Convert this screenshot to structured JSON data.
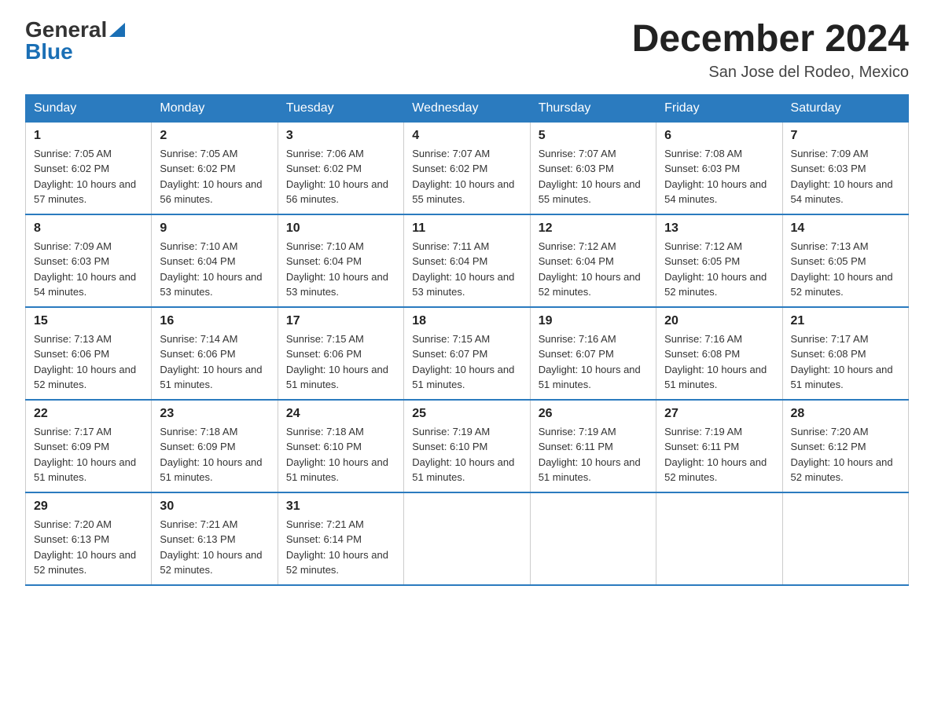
{
  "header": {
    "logo_general": "General",
    "logo_blue": "Blue",
    "title": "December 2024",
    "subtitle": "San Jose del Rodeo, Mexico"
  },
  "columns": [
    "Sunday",
    "Monday",
    "Tuesday",
    "Wednesday",
    "Thursday",
    "Friday",
    "Saturday"
  ],
  "weeks": [
    [
      {
        "day": "1",
        "sunrise": "7:05 AM",
        "sunset": "6:02 PM",
        "daylight": "10 hours and 57 minutes."
      },
      {
        "day": "2",
        "sunrise": "7:05 AM",
        "sunset": "6:02 PM",
        "daylight": "10 hours and 56 minutes."
      },
      {
        "day": "3",
        "sunrise": "7:06 AM",
        "sunset": "6:02 PM",
        "daylight": "10 hours and 56 minutes."
      },
      {
        "day": "4",
        "sunrise": "7:07 AM",
        "sunset": "6:02 PM",
        "daylight": "10 hours and 55 minutes."
      },
      {
        "day": "5",
        "sunrise": "7:07 AM",
        "sunset": "6:03 PM",
        "daylight": "10 hours and 55 minutes."
      },
      {
        "day": "6",
        "sunrise": "7:08 AM",
        "sunset": "6:03 PM",
        "daylight": "10 hours and 54 minutes."
      },
      {
        "day": "7",
        "sunrise": "7:09 AM",
        "sunset": "6:03 PM",
        "daylight": "10 hours and 54 minutes."
      }
    ],
    [
      {
        "day": "8",
        "sunrise": "7:09 AM",
        "sunset": "6:03 PM",
        "daylight": "10 hours and 54 minutes."
      },
      {
        "day": "9",
        "sunrise": "7:10 AM",
        "sunset": "6:04 PM",
        "daylight": "10 hours and 53 minutes."
      },
      {
        "day": "10",
        "sunrise": "7:10 AM",
        "sunset": "6:04 PM",
        "daylight": "10 hours and 53 minutes."
      },
      {
        "day": "11",
        "sunrise": "7:11 AM",
        "sunset": "6:04 PM",
        "daylight": "10 hours and 53 minutes."
      },
      {
        "day": "12",
        "sunrise": "7:12 AM",
        "sunset": "6:04 PM",
        "daylight": "10 hours and 52 minutes."
      },
      {
        "day": "13",
        "sunrise": "7:12 AM",
        "sunset": "6:05 PM",
        "daylight": "10 hours and 52 minutes."
      },
      {
        "day": "14",
        "sunrise": "7:13 AM",
        "sunset": "6:05 PM",
        "daylight": "10 hours and 52 minutes."
      }
    ],
    [
      {
        "day": "15",
        "sunrise": "7:13 AM",
        "sunset": "6:06 PM",
        "daylight": "10 hours and 52 minutes."
      },
      {
        "day": "16",
        "sunrise": "7:14 AM",
        "sunset": "6:06 PM",
        "daylight": "10 hours and 51 minutes."
      },
      {
        "day": "17",
        "sunrise": "7:15 AM",
        "sunset": "6:06 PM",
        "daylight": "10 hours and 51 minutes."
      },
      {
        "day": "18",
        "sunrise": "7:15 AM",
        "sunset": "6:07 PM",
        "daylight": "10 hours and 51 minutes."
      },
      {
        "day": "19",
        "sunrise": "7:16 AM",
        "sunset": "6:07 PM",
        "daylight": "10 hours and 51 minutes."
      },
      {
        "day": "20",
        "sunrise": "7:16 AM",
        "sunset": "6:08 PM",
        "daylight": "10 hours and 51 minutes."
      },
      {
        "day": "21",
        "sunrise": "7:17 AM",
        "sunset": "6:08 PM",
        "daylight": "10 hours and 51 minutes."
      }
    ],
    [
      {
        "day": "22",
        "sunrise": "7:17 AM",
        "sunset": "6:09 PM",
        "daylight": "10 hours and 51 minutes."
      },
      {
        "day": "23",
        "sunrise": "7:18 AM",
        "sunset": "6:09 PM",
        "daylight": "10 hours and 51 minutes."
      },
      {
        "day": "24",
        "sunrise": "7:18 AM",
        "sunset": "6:10 PM",
        "daylight": "10 hours and 51 minutes."
      },
      {
        "day": "25",
        "sunrise": "7:19 AM",
        "sunset": "6:10 PM",
        "daylight": "10 hours and 51 minutes."
      },
      {
        "day": "26",
        "sunrise": "7:19 AM",
        "sunset": "6:11 PM",
        "daylight": "10 hours and 51 minutes."
      },
      {
        "day": "27",
        "sunrise": "7:19 AM",
        "sunset": "6:11 PM",
        "daylight": "10 hours and 52 minutes."
      },
      {
        "day": "28",
        "sunrise": "7:20 AM",
        "sunset": "6:12 PM",
        "daylight": "10 hours and 52 minutes."
      }
    ],
    [
      {
        "day": "29",
        "sunrise": "7:20 AM",
        "sunset": "6:13 PM",
        "daylight": "10 hours and 52 minutes."
      },
      {
        "day": "30",
        "sunrise": "7:21 AM",
        "sunset": "6:13 PM",
        "daylight": "10 hours and 52 minutes."
      },
      {
        "day": "31",
        "sunrise": "7:21 AM",
        "sunset": "6:14 PM",
        "daylight": "10 hours and 52 minutes."
      },
      null,
      null,
      null,
      null
    ]
  ]
}
